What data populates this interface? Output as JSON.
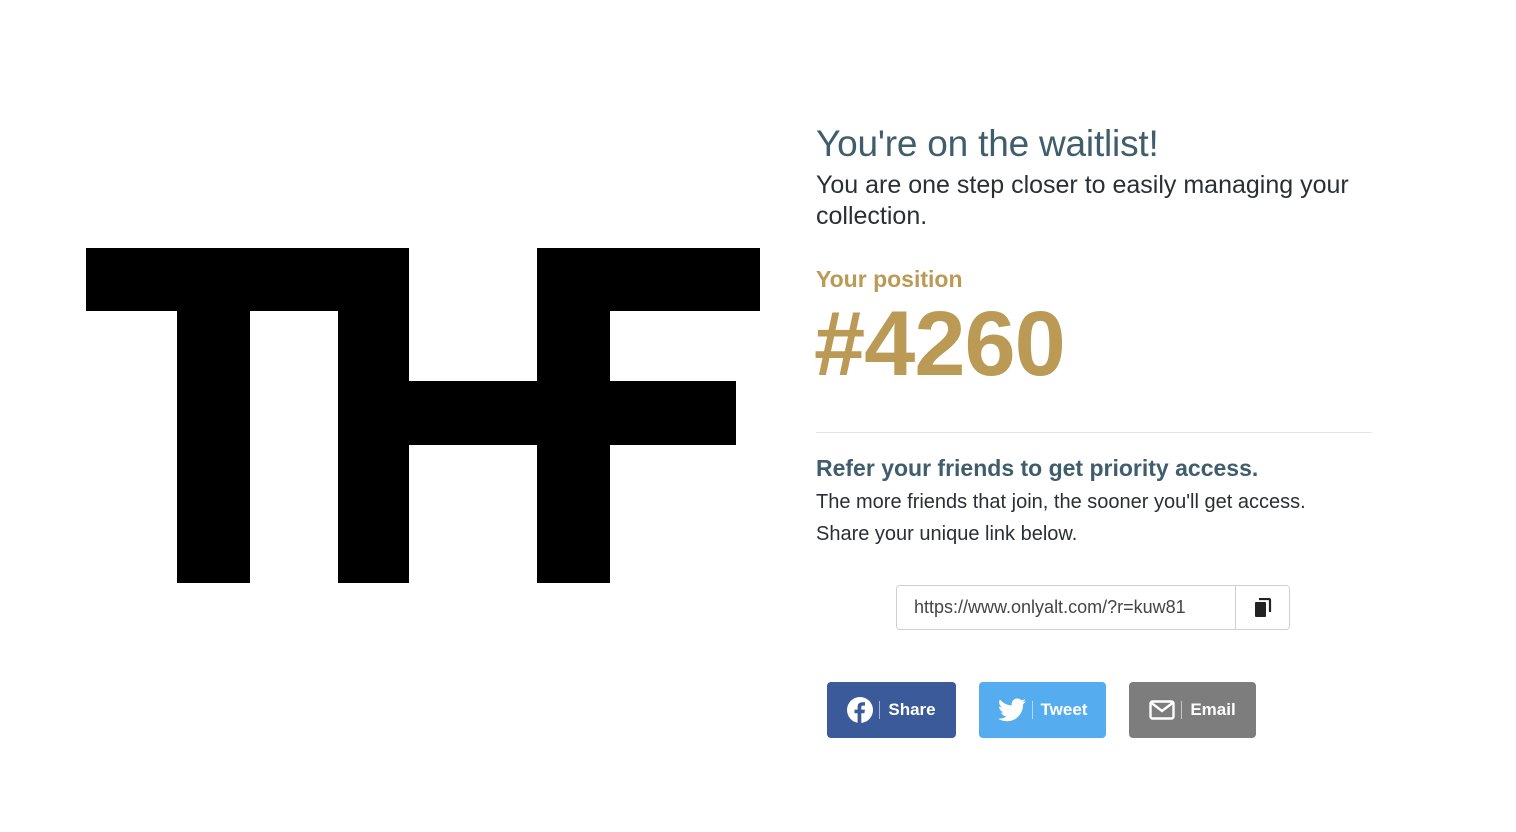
{
  "logo": {
    "alt_text": "THF"
  },
  "waitlist": {
    "headline": "You're on the waitlist!",
    "subline": "You are one step closer to easily managing your collection.",
    "position_label": "Your position",
    "position_value": "#4260"
  },
  "referral": {
    "title": "Refer your friends to get priority access.",
    "text_line1": "The more friends that join, the sooner you'll get access.",
    "text_line2": "Share your unique link below.",
    "link_value": "https://www.onlyalt.com/?r=kuw81"
  },
  "share_buttons": {
    "facebook_label": "Share",
    "twitter_label": "Tweet",
    "email_label": "Email"
  },
  "colors": {
    "accent_gold": "#bb9a56",
    "heading_slate": "#3f5d6b",
    "facebook": "#3b5a9a",
    "twitter": "#55acee",
    "email": "#7d7d7d"
  },
  "icons": {
    "copy": "copy-icon",
    "facebook": "facebook-icon",
    "twitter": "twitter-icon",
    "email": "envelope-icon"
  }
}
